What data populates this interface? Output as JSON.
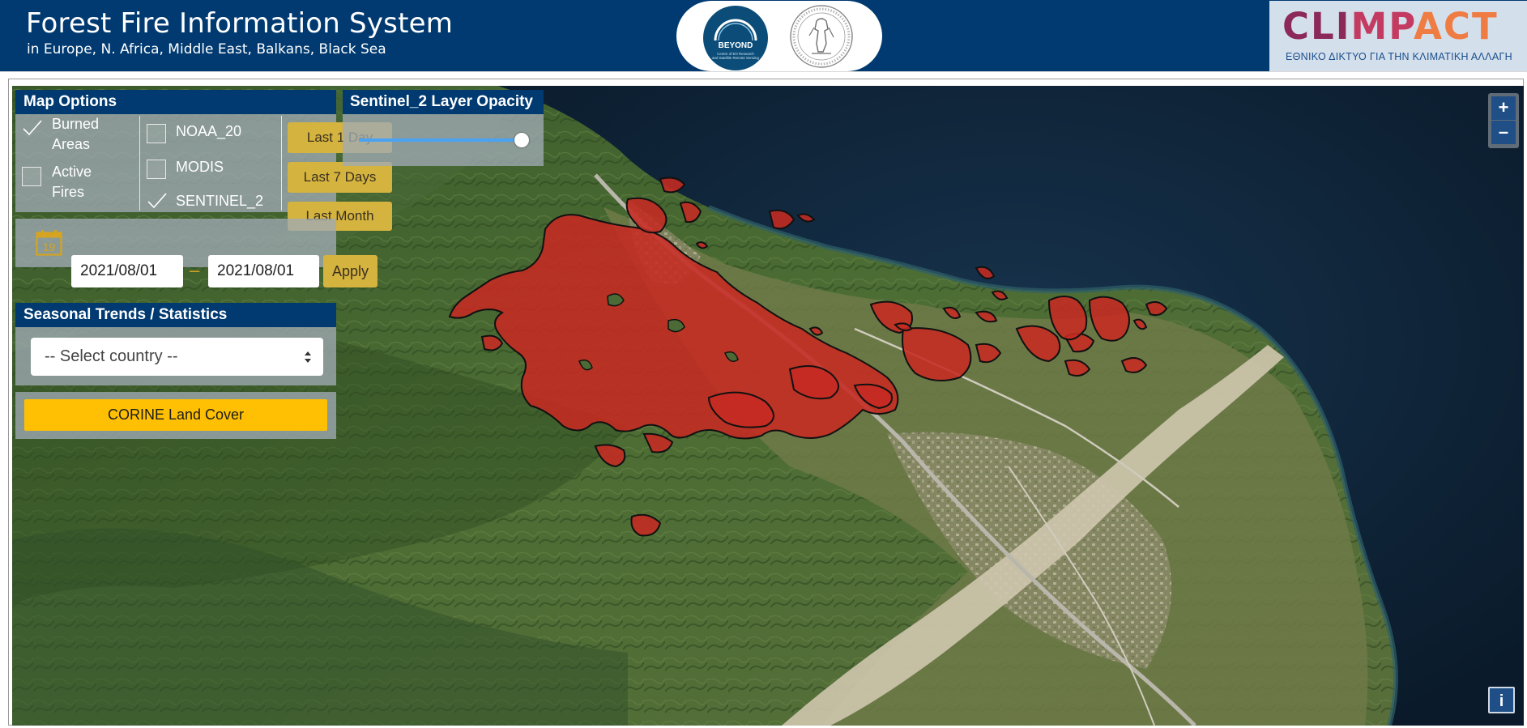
{
  "header": {
    "title": "Forest Fire Information System",
    "subtitle": "in Europe, N. Africa, Middle East, Balkans, Black Sea",
    "beyond_logo": {
      "name": "BEYOND",
      "tagline_1": "Centre of EO Research",
      "tagline_2": "and Satellite Remote Sensing"
    },
    "noa_logo_icon": "national-observatory-of-athens-seal-icon",
    "climpact": {
      "word": "CLIMPACT",
      "subtitle": "ΕΘΝΙΚΟ ΔΙΚΤΥΟ ΓΙΑ ΤΗΝ ΚΛΙΜΑΤΙΚΗ ΑΛΛΑΓΗ"
    }
  },
  "map_options": {
    "title": "Map Options",
    "layers": [
      {
        "label_1": "Burned",
        "label_2": "Areas",
        "checked": true
      },
      {
        "label_1": "Active",
        "label_2": "Fires",
        "checked": false
      }
    ],
    "sources": [
      {
        "label": "NOAA_20",
        "checked": false
      },
      {
        "label": "MODIS",
        "checked": false
      },
      {
        "label": "SENTINEL_2",
        "checked": true
      }
    ],
    "periods": [
      "Last 1 Day",
      "Last 7 Days",
      "Last Month"
    ],
    "calendar_icon_day": "19",
    "date_from": "2021/08/01",
    "date_separator": "–",
    "date_to": "2021/08/01",
    "apply_label": "Apply"
  },
  "opacity": {
    "title": "Sentinel_2 Layer Opacity",
    "value_fraction": 1.0
  },
  "seasonal": {
    "title": "Seasonal Trends / Statistics",
    "select_value": "-- Select country --"
  },
  "corine_label": "CORINE Land Cover",
  "zoom": {
    "in_label": "+",
    "out_label": "–"
  },
  "info_label": "i",
  "colors": {
    "header_bg": "#003a70",
    "accent_gold": "#d5b33f",
    "corine_yellow": "#ffc003",
    "burned_red": "#c62a22",
    "sea": "#0e2236"
  }
}
